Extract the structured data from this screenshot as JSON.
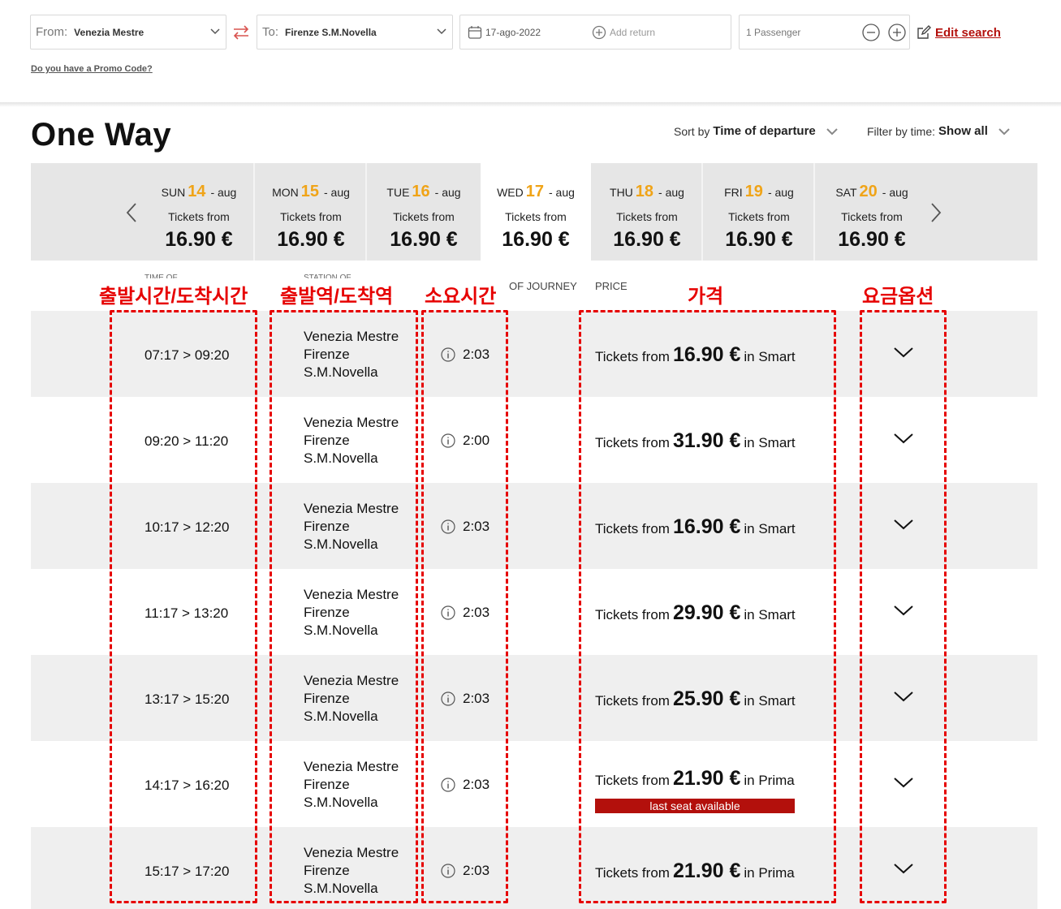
{
  "search": {
    "from_label": "From:",
    "from_value": "Venezia Mestre",
    "to_label": "To:",
    "to_value": "Firenze S.M.Novella",
    "date": "17-ago-2022",
    "add_return": "Add return",
    "passengers": "1 Passenger",
    "edit_search": "Edit search",
    "promo": "Do you have a Promo Code?"
  },
  "heading": {
    "title": "One Way",
    "sort_label": "Sort by",
    "sort_value": "Time of departure",
    "filter_label": "Filter by time:",
    "filter_value": "Show all"
  },
  "days": [
    {
      "dow": "SUN",
      "num": "14",
      "month": "- aug",
      "from": "Tickets from",
      "price": "16.90 €"
    },
    {
      "dow": "MON",
      "num": "15",
      "month": "- aug",
      "from": "Tickets from",
      "price": "16.90 €"
    },
    {
      "dow": "TUE",
      "num": "16",
      "month": "- aug",
      "from": "Tickets from",
      "price": "16.90 €"
    },
    {
      "dow": "WED",
      "num": "17",
      "month": "- aug",
      "from": "Tickets from",
      "price": "16.90 €"
    },
    {
      "dow": "THU",
      "num": "18",
      "month": "- aug",
      "from": "Tickets from",
      "price": "16.90 €"
    },
    {
      "dow": "FRI",
      "num": "19",
      "month": "- aug",
      "from": "Tickets from",
      "price": "16.90 €"
    },
    {
      "dow": "SAT",
      "num": "20",
      "month": "- aug",
      "from": "Tickets from",
      "price": "16.90 €"
    }
  ],
  "columns": {
    "time_cut": "TIME OF",
    "station_cut": "STATION OF",
    "journey": "OF JOURNEY",
    "price": "PRICE"
  },
  "annotations": {
    "time": "출발시간/도착시간",
    "station": "출발역/도착역",
    "duration": "소요시간",
    "price": "가격",
    "options": "요금옵션"
  },
  "rows": [
    {
      "time": "07:17 > 09:20",
      "st1": "Venezia Mestre",
      "st2": "Firenze",
      "st3": "S.M.Novella",
      "dur": "2:03",
      "pre": "Tickets from",
      "price": "16.90 €",
      "post": "in Smart",
      "badge": ""
    },
    {
      "time": "09:20 > 11:20",
      "st1": "Venezia Mestre",
      "st2": "Firenze",
      "st3": "S.M.Novella",
      "dur": "2:00",
      "pre": "Tickets from",
      "price": "31.90 €",
      "post": "in Smart",
      "badge": ""
    },
    {
      "time": "10:17 > 12:20",
      "st1": "Venezia Mestre",
      "st2": "Firenze",
      "st3": "S.M.Novella",
      "dur": "2:03",
      "pre": "Tickets from",
      "price": "16.90 €",
      "post": "in Smart",
      "badge": ""
    },
    {
      "time": "11:17 > 13:20",
      "st1": "Venezia Mestre",
      "st2": "Firenze",
      "st3": "S.M.Novella",
      "dur": "2:03",
      "pre": "Tickets from",
      "price": "29.90 €",
      "post": "in Smart",
      "badge": ""
    },
    {
      "time": "13:17 > 15:20",
      "st1": "Venezia Mestre",
      "st2": "Firenze",
      "st3": "S.M.Novella",
      "dur": "2:03",
      "pre": "Tickets from",
      "price": "25.90 €",
      "post": "in Smart",
      "badge": ""
    },
    {
      "time": "14:17 > 16:20",
      "st1": "Venezia Mestre",
      "st2": "Firenze",
      "st3": "S.M.Novella",
      "dur": "2:03",
      "pre": "Tickets from",
      "price": "21.90 €",
      "post": "in Prima",
      "badge": "last seat available"
    },
    {
      "time": "15:17 > 17:20",
      "st1": "Venezia Mestre",
      "st2": "Firenze",
      "st3": "S.M.Novella",
      "dur": "2:03",
      "pre": "Tickets from",
      "price": "21.90 €",
      "post": "in Prima",
      "badge": ""
    }
  ]
}
